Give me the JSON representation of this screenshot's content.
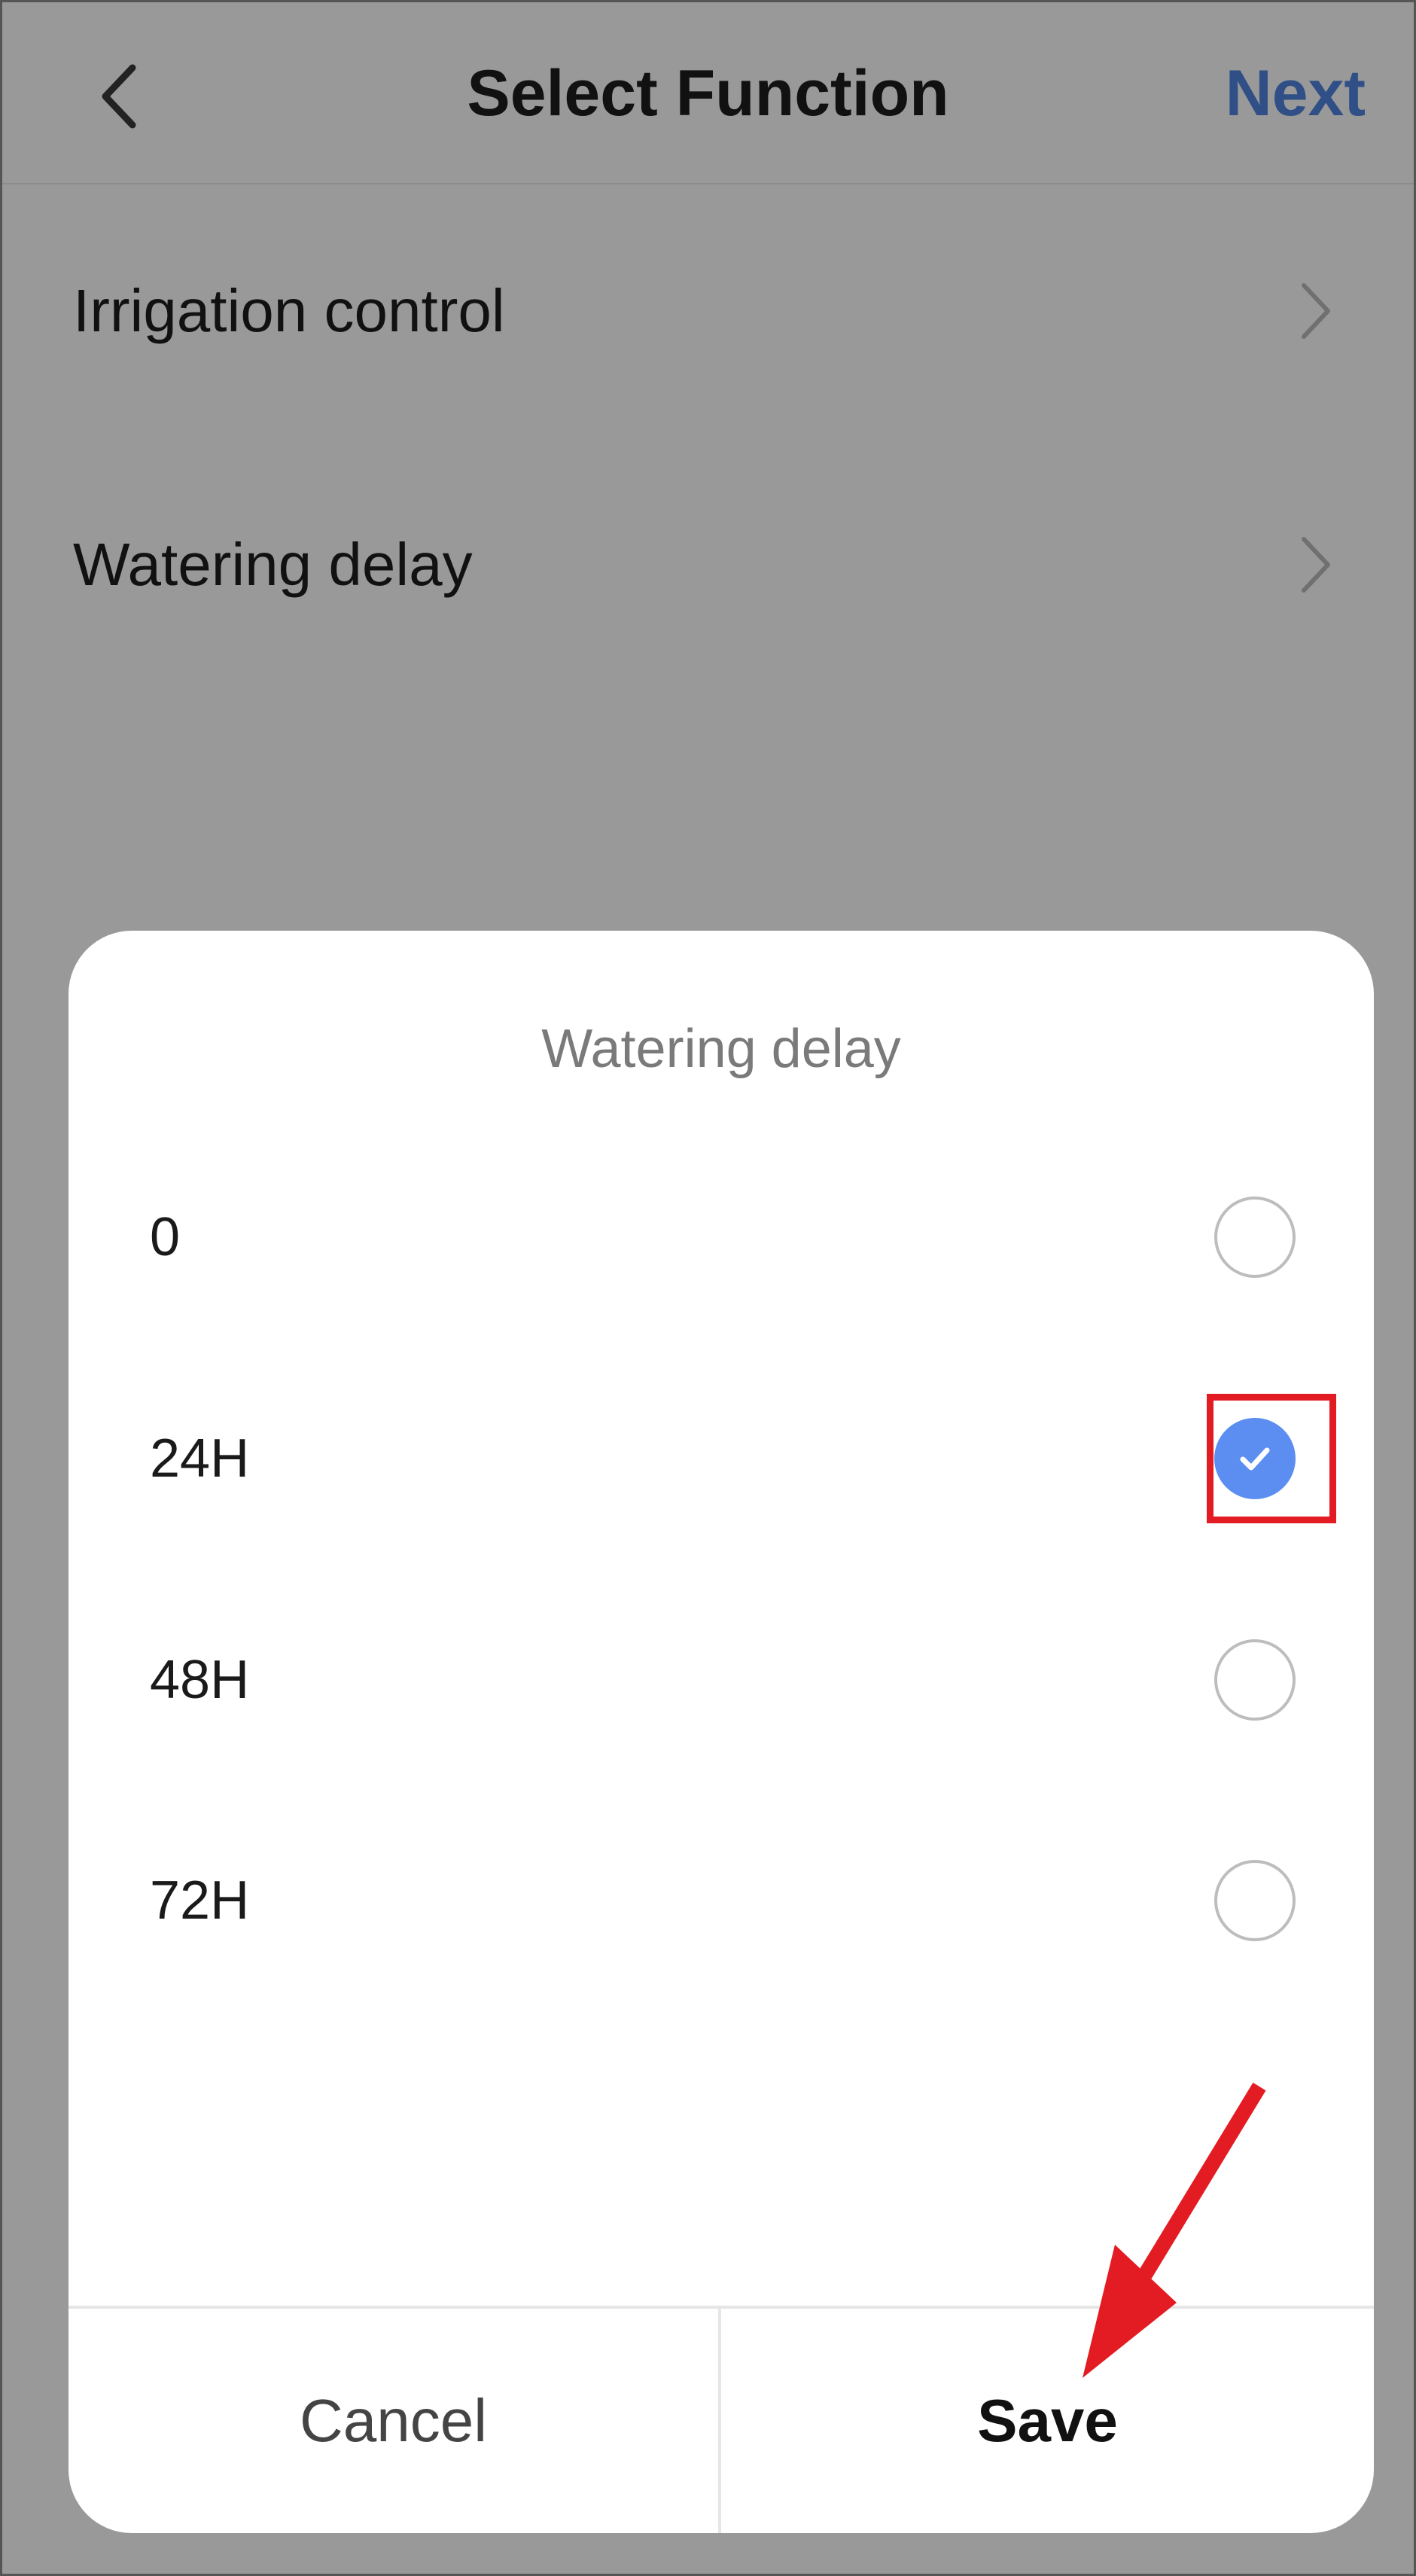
{
  "header": {
    "title": "Select Function",
    "next_label": "Next"
  },
  "menu": [
    {
      "label": "Irrigation control"
    },
    {
      "label": "Watering delay"
    }
  ],
  "dialog": {
    "title": "Watering delay",
    "options": [
      {
        "label": "0",
        "selected": false
      },
      {
        "label": "24H",
        "selected": true
      },
      {
        "label": "48H",
        "selected": false
      },
      {
        "label": "72H",
        "selected": false
      }
    ],
    "cancel_label": "Cancel",
    "save_label": "Save"
  },
  "colors": {
    "overlay": "#999999",
    "accent_next": "#304f86",
    "radio_checked": "#5b8ef0",
    "annotation_red": "#e31c23"
  },
  "icons": {
    "back": "chevron-left-icon",
    "row_chevron": "chevron-right-icon",
    "check": "check-icon",
    "annotation": "red-arrow-icon"
  }
}
